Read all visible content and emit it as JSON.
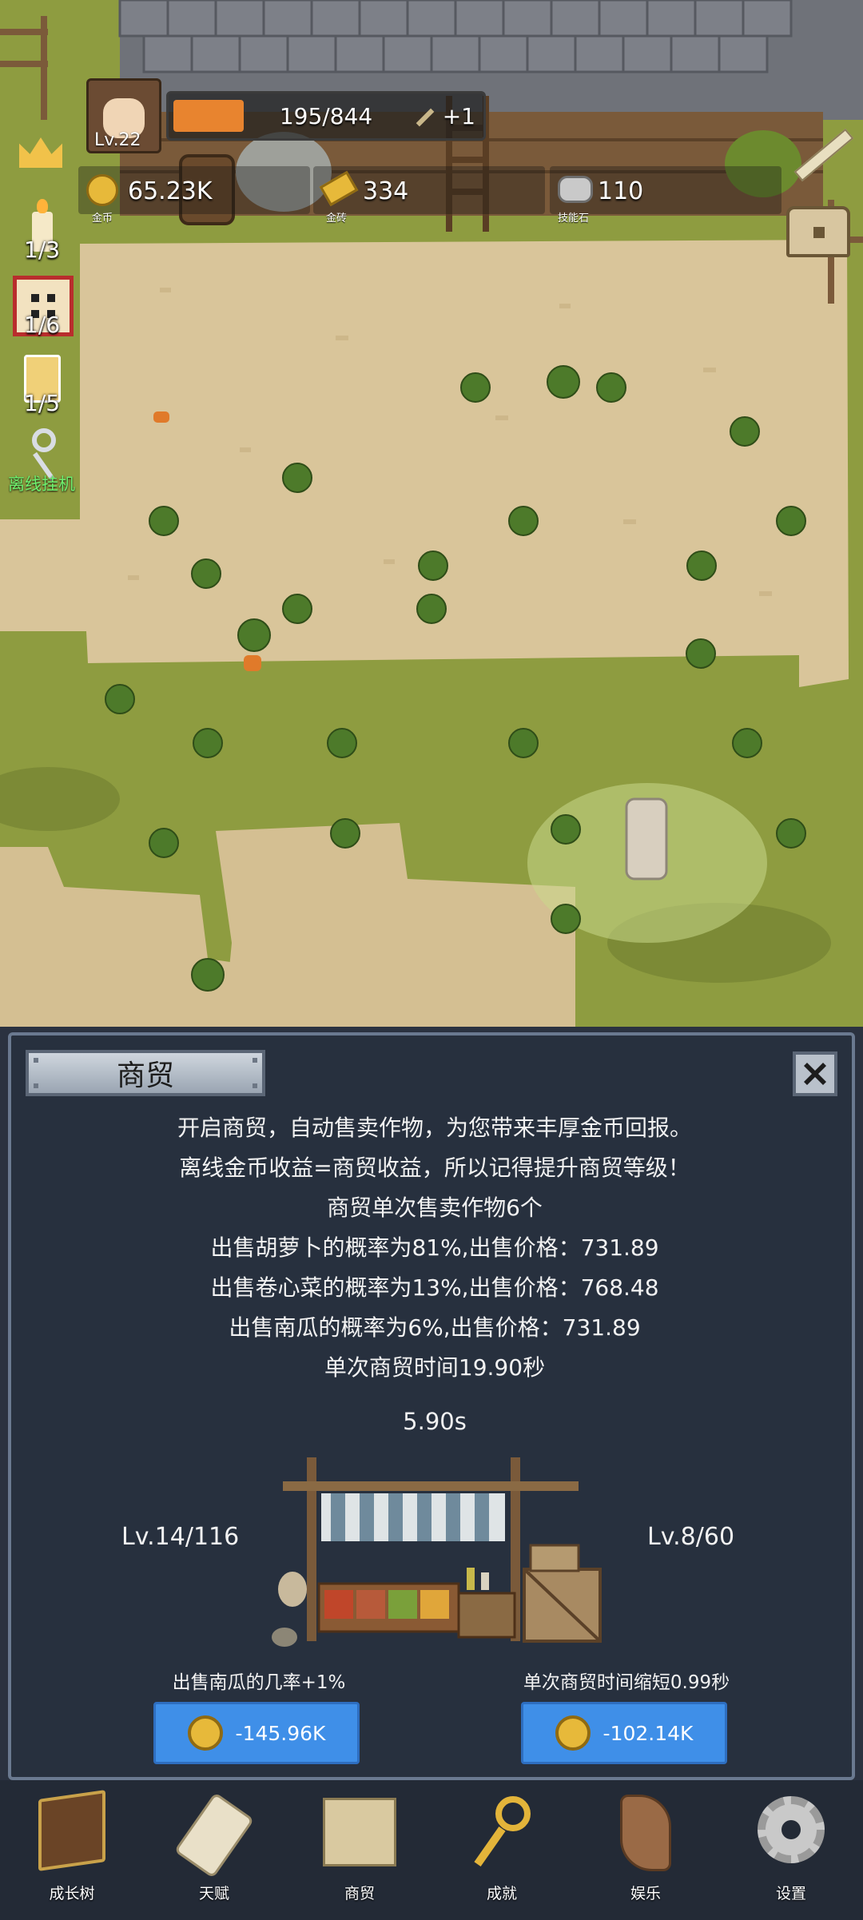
{
  "hud": {
    "level": "Lv.22",
    "xp_text": "195/844",
    "xp_progress": 0.231,
    "xp_bonus": "+1",
    "gold_value": "65.23K",
    "gold_label": "金币",
    "bar_value": "334",
    "bar_label": "金砖",
    "stone_value": "110",
    "stone_label": "技能石"
  },
  "side": {
    "candle_count": "1/3",
    "dice_count": "1/6",
    "drink_count": "1/5",
    "afk_label": "离线挂机"
  },
  "panel": {
    "title": "商贸",
    "lines": [
      "开启商贸，自动售卖作物，为您带来丰厚金币回报。",
      "离线金币收益=商贸收益，所以记得提升商贸等级！",
      "商贸单次售卖作物6个",
      "出售胡萝卜的概率为81%,出售价格：731.89",
      "出售卷心菜的概率为13%,出售价格：768.48",
      "出售南瓜的概率为6%,出售价格：731.89",
      "单次商贸时间19.90秒"
    ],
    "timer": "5.90s",
    "left_level": "Lv.14/116",
    "right_level": "Lv.8/60",
    "left_upgrade_label": "出售南瓜的几率+1%",
    "right_upgrade_label": "单次商贸时间缩短0.99秒",
    "left_cost": "-145.96K",
    "right_cost": "-102.14K"
  },
  "nav": [
    "成长树",
    "天赋",
    "商贸",
    "成就",
    "娱乐",
    "设置"
  ],
  "colors": {
    "panel_bg": "#27303e",
    "button_blue": "#3f8fe8",
    "xp_fill": "#e8842f",
    "grass": "#8c9a3d",
    "dirt": "#d8c49a"
  }
}
